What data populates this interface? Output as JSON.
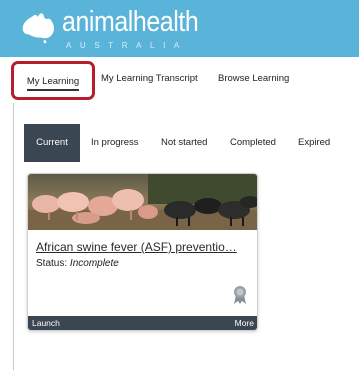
{
  "brand": {
    "name": "animalhealth",
    "sub": "AUSTRALIA",
    "header_color": "#5ab3d9"
  },
  "nav": {
    "items": [
      {
        "label": "My Learning",
        "state": "selected"
      },
      {
        "label": "My Learning Transcript"
      },
      {
        "label": "Browse Learning"
      }
    ],
    "highlight_color": "#b51e2b"
  },
  "tabs": [
    {
      "label": "Current",
      "state": "selected"
    },
    {
      "label": "In progress"
    },
    {
      "label": "Not started"
    },
    {
      "label": "Completed"
    },
    {
      "label": "Expired"
    }
  ],
  "course_card": {
    "image": "pigs-photo",
    "title": "African swine fever (ASF) preventio…",
    "status_label": "Status:",
    "status_value": "Incomplete",
    "badge_icon": "award-ribbon-icon",
    "launch_label": "Launch",
    "more_label": "More",
    "footer_color": "#3a4651"
  }
}
